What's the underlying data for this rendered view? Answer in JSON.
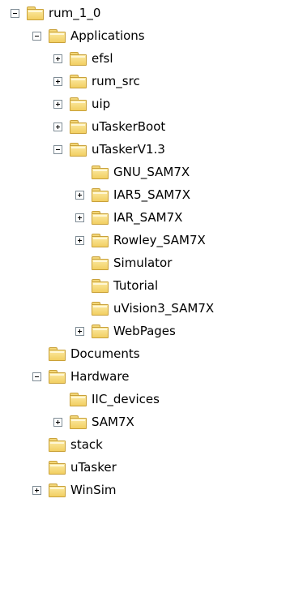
{
  "tree": {
    "nodes": [
      {
        "label": "rum_1_0",
        "state": "expanded"
      },
      {
        "label": "Applications",
        "state": "expanded"
      },
      {
        "label": "efsl",
        "state": "collapsed"
      },
      {
        "label": "rum_src",
        "state": "collapsed"
      },
      {
        "label": "uip",
        "state": "collapsed"
      },
      {
        "label": "uTaskerBoot",
        "state": "collapsed"
      },
      {
        "label": "uTaskerV1.3",
        "state": "expanded"
      },
      {
        "label": "GNU_SAM7X",
        "state": "leaf"
      },
      {
        "label": "IAR5_SAM7X",
        "state": "collapsed"
      },
      {
        "label": "IAR_SAM7X",
        "state": "collapsed"
      },
      {
        "label": "Rowley_SAM7X",
        "state": "collapsed"
      },
      {
        "label": "Simulator",
        "state": "leaf"
      },
      {
        "label": "Tutorial",
        "state": "leaf"
      },
      {
        "label": "uVision3_SAM7X",
        "state": "leaf"
      },
      {
        "label": "WebPages",
        "state": "collapsed"
      },
      {
        "label": "Documents",
        "state": "leaf"
      },
      {
        "label": "Hardware",
        "state": "expanded"
      },
      {
        "label": "IIC_devices",
        "state": "leaf"
      },
      {
        "label": "SAM7X",
        "state": "collapsed"
      },
      {
        "label": "stack",
        "state": "leaf"
      },
      {
        "label": "uTasker",
        "state": "leaf"
      },
      {
        "label": "WinSim",
        "state": "collapsed"
      }
    ]
  },
  "colors": {
    "folder_fill": "#f2cf62",
    "folder_border": "#c9a13a",
    "expander_border": "#7f8c95",
    "background": "#ffffff"
  },
  "icons": {
    "folder": "folder-icon",
    "expand": "expand-plus-icon",
    "collapse": "collapse-minus-icon"
  }
}
